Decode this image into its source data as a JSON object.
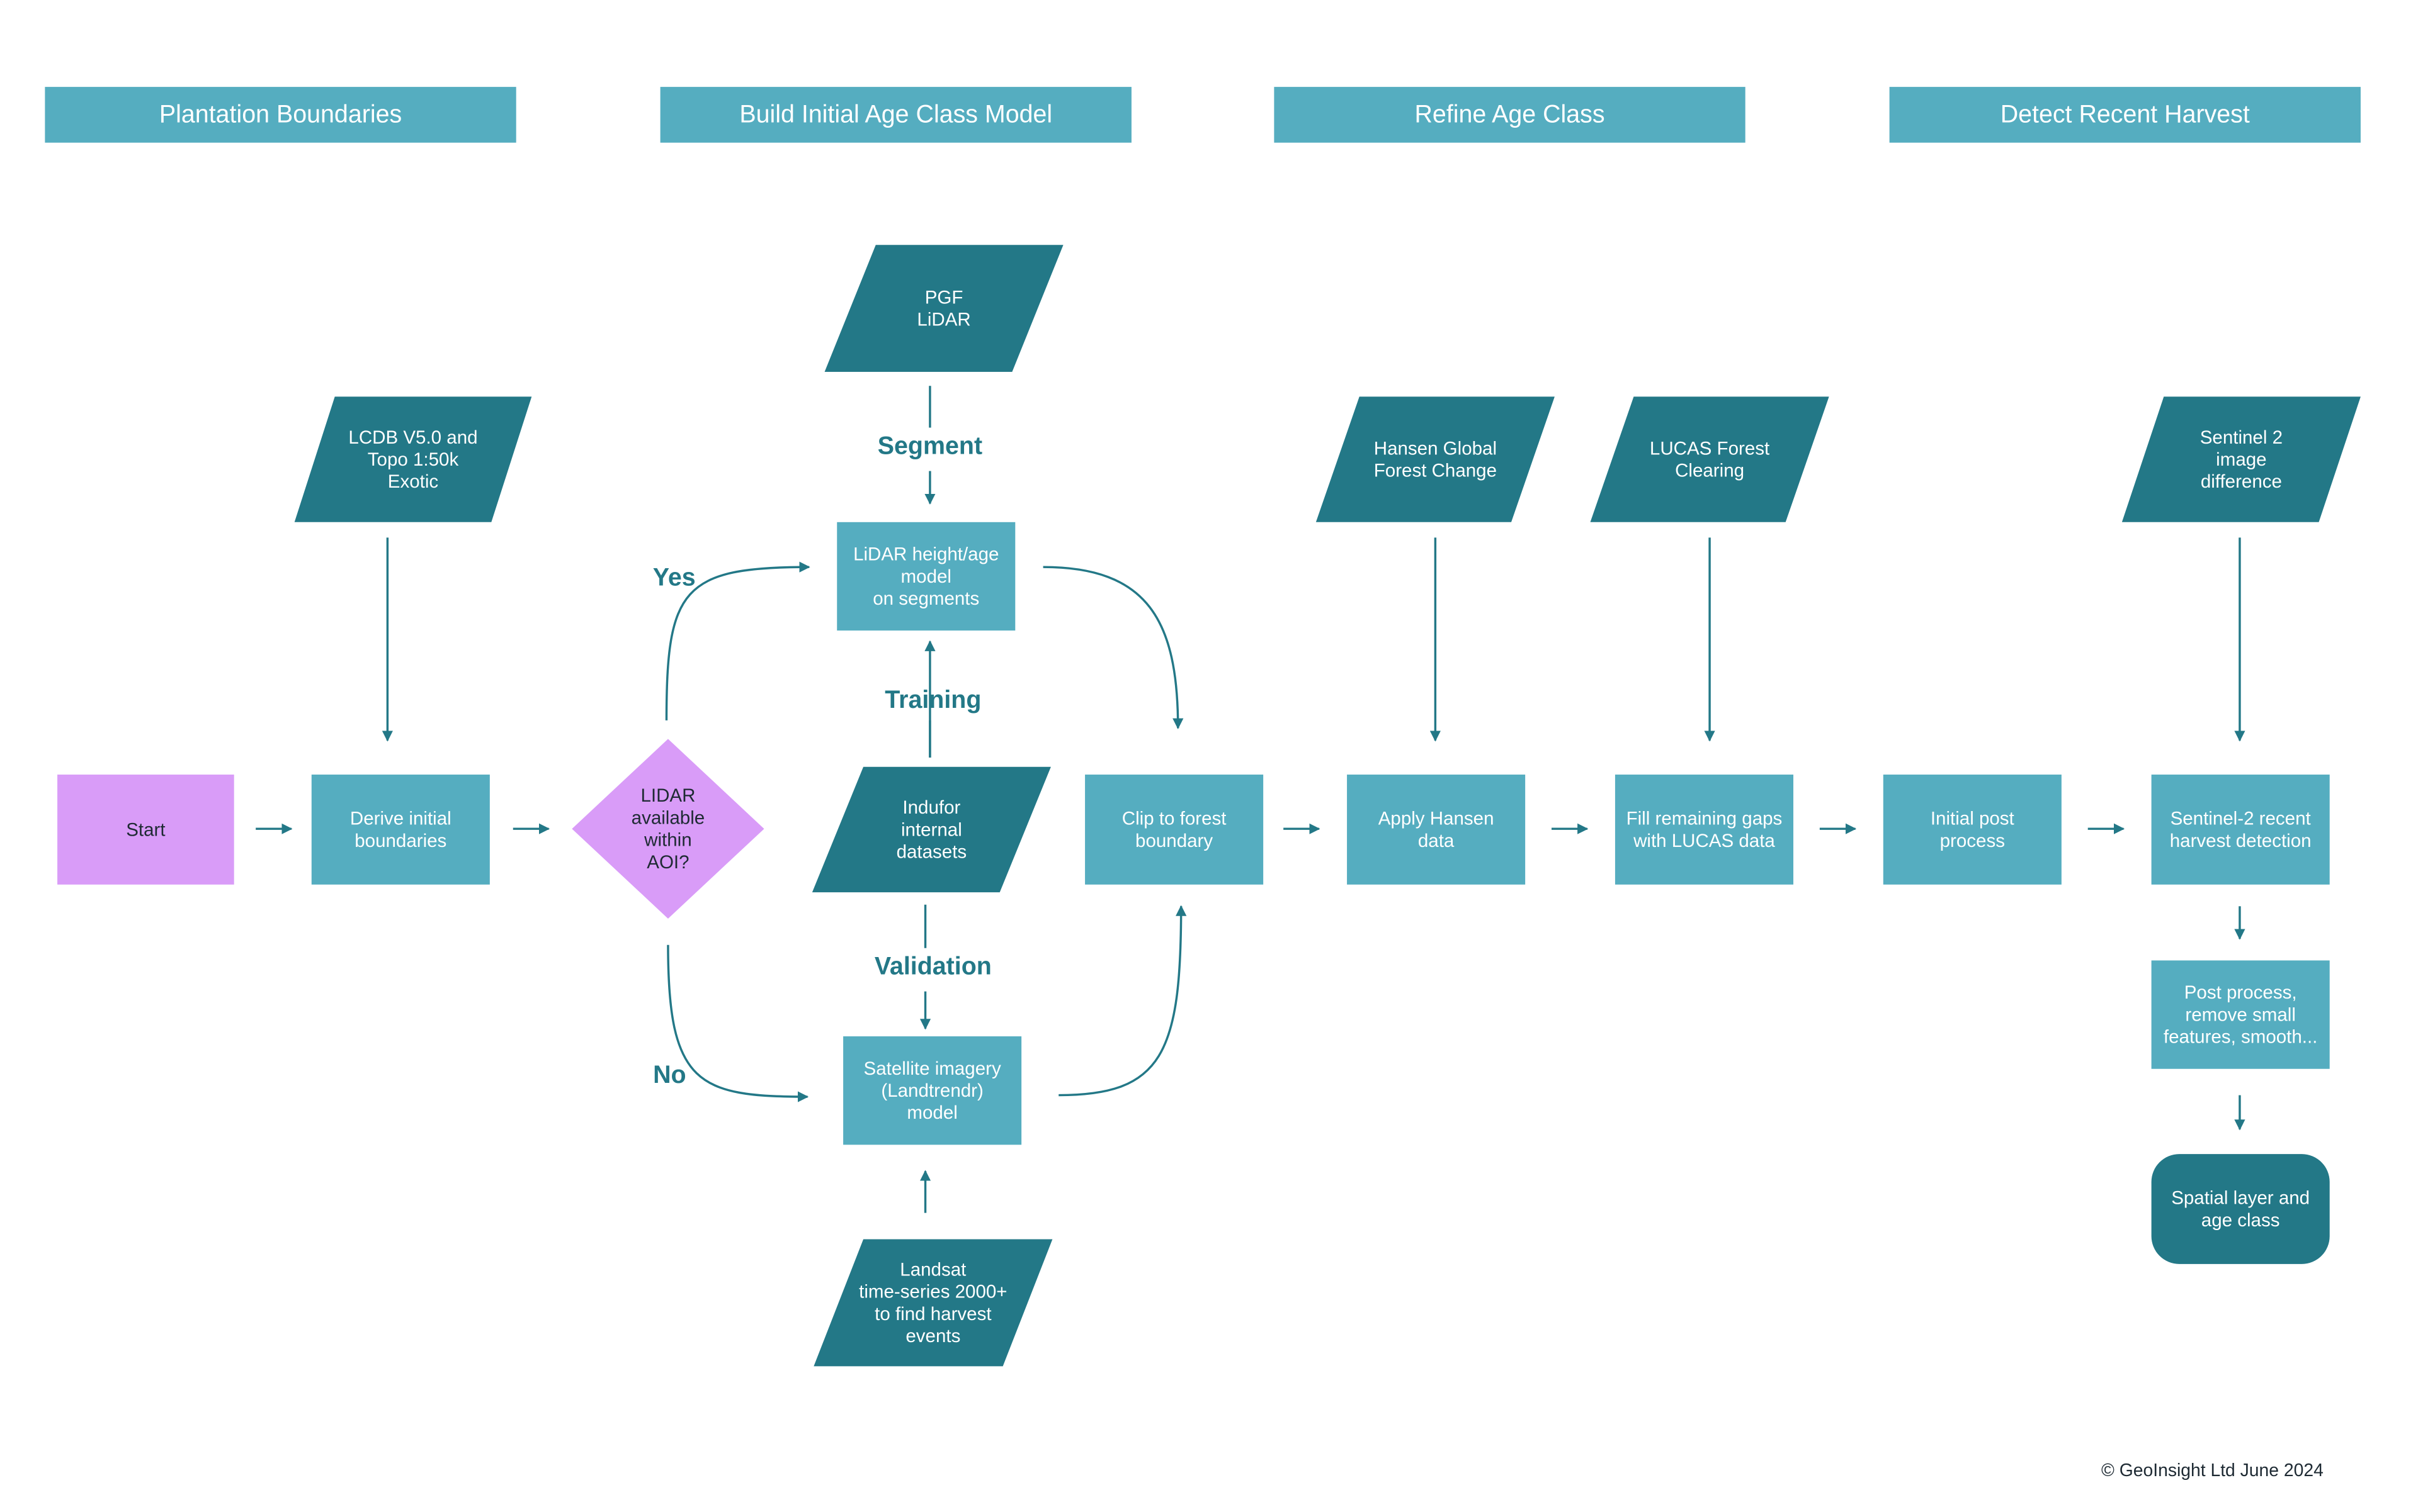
{
  "colors": {
    "header": "#55adc0",
    "process": "#55adc0",
    "data": "#237887",
    "start": "#d99cf8",
    "text_label": "#237887"
  },
  "headers": [
    "Plantation Boundaries",
    "Build Initial Age Class Model",
    "Refine Age Class",
    "Detect Recent Harvest"
  ],
  "nodes": {
    "start": [
      "Start"
    ],
    "lcdb": [
      "LCDB V5.0 and",
      "Topo 1:50k",
      "Exotic"
    ],
    "derive": [
      "Derive initial",
      "boundaries"
    ],
    "decision": [
      "LIDAR",
      "available",
      "within",
      "AOI?"
    ],
    "pgf": [
      "PGF",
      "LiDAR"
    ],
    "lidar_model": [
      "LiDAR height/age",
      "model",
      "on segments"
    ],
    "indufor": [
      "Indufor",
      "internal",
      "datasets"
    ],
    "satellite": [
      "Satellite imagery",
      "(Landtrendr)",
      "model"
    ],
    "landsat": [
      "Landsat",
      "time-series 2000+",
      "to find harvest",
      "events"
    ],
    "clip": [
      "Clip to forest",
      "boundary"
    ],
    "hansen": [
      "Hansen Global",
      "Forest Change"
    ],
    "apply_hansen": [
      "Apply Hansen",
      "data"
    ],
    "lucas": [
      "LUCAS Forest",
      "Clearing"
    ],
    "fill": [
      "Fill remaining gaps",
      "with LUCAS data"
    ],
    "initial_post": [
      "Initial post",
      "process"
    ],
    "sentinel_data": [
      "Sentinel 2",
      "image",
      "difference"
    ],
    "sentinel_detect": [
      "Sentinel-2 recent",
      "harvest detection"
    ],
    "post_process": [
      "Post process,",
      "remove small",
      "features, smooth..."
    ],
    "spatial": [
      "Spatial layer and",
      "age class"
    ]
  },
  "edge_labels": {
    "segment": "Segment",
    "training": "Training",
    "validation": "Validation",
    "yes": "Yes",
    "no": "No"
  },
  "footer": "© GeoInsight Ltd June 2024"
}
